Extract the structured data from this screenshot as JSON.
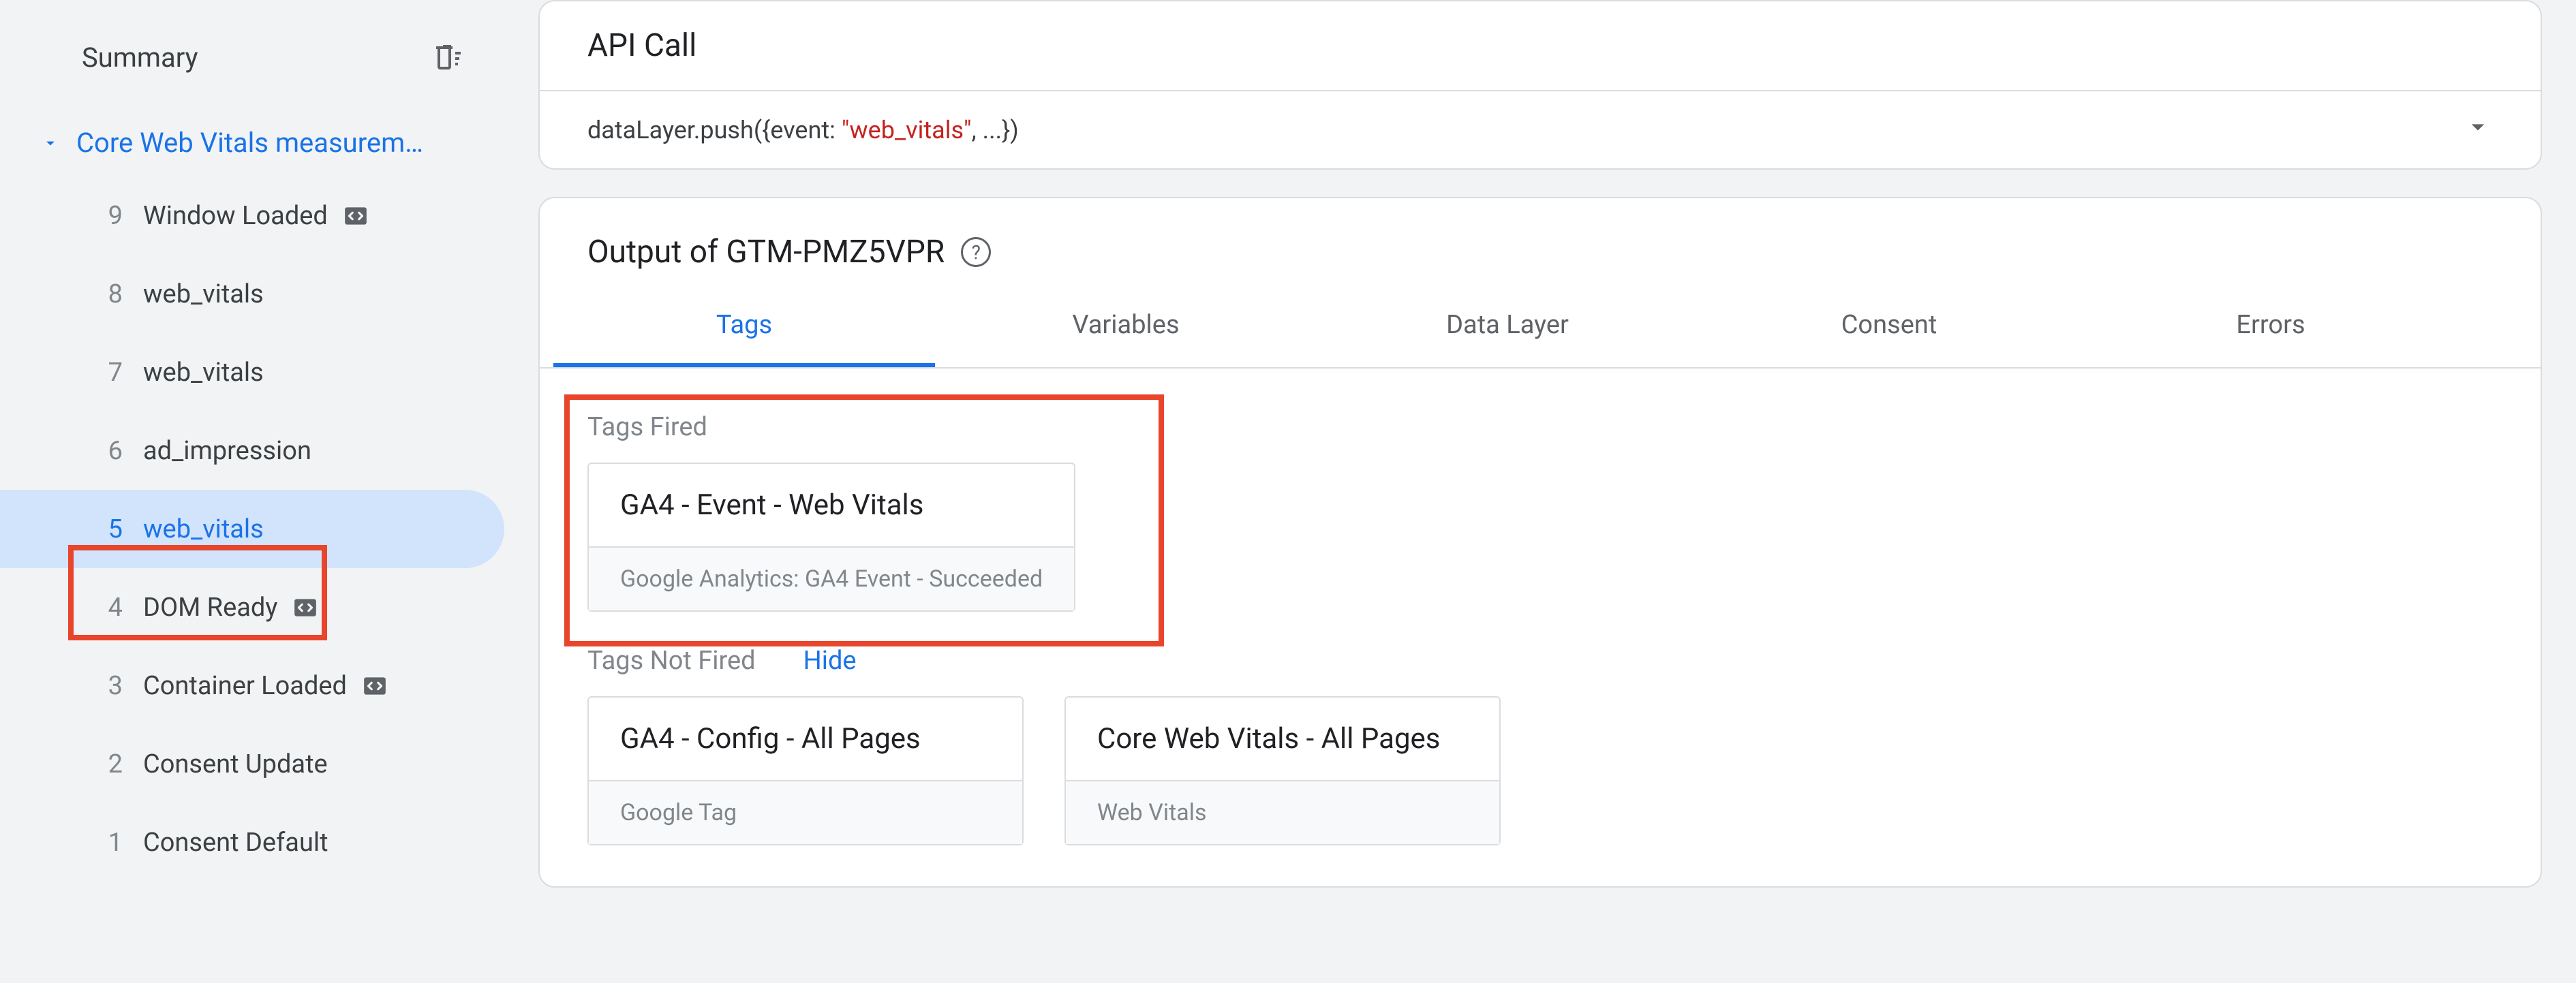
{
  "sidebar": {
    "title": "Summary",
    "group_label": "Core Web Vitals measurem…",
    "events": [
      {
        "num": "9",
        "label": "Window Loaded",
        "icon": true
      },
      {
        "num": "8",
        "label": "web_vitals",
        "icon": false
      },
      {
        "num": "7",
        "label": "web_vitals",
        "icon": false
      },
      {
        "num": "6",
        "label": "ad_impression",
        "icon": false
      },
      {
        "num": "5",
        "label": "web_vitals",
        "icon": false,
        "active": true
      },
      {
        "num": "4",
        "label": "DOM Ready",
        "icon": true
      },
      {
        "num": "3",
        "label": "Container Loaded",
        "icon": true
      },
      {
        "num": "2",
        "label": "Consent Update",
        "icon": false
      },
      {
        "num": "1",
        "label": "Consent Default",
        "icon": false
      }
    ]
  },
  "api": {
    "title": "API Call",
    "code_pre": "dataLayer.push({event: ",
    "code_str": "\"web_vitals\"",
    "code_post": ", ...})"
  },
  "output": {
    "title_pre": "Output of ",
    "container_id": "GTM-PMZ5VPR",
    "help": "?",
    "tabs": [
      "Tags",
      "Variables",
      "Data Layer",
      "Consent",
      "Errors"
    ],
    "active_tab": 0,
    "fired_title": "Tags Fired",
    "not_fired_title": "Tags Not Fired",
    "hide_label": "Hide",
    "fired": [
      {
        "name": "GA4 - Event - Web Vitals",
        "meta": "Google Analytics: GA4 Event - Succeeded"
      }
    ],
    "not_fired": [
      {
        "name": "GA4 - Config - All Pages",
        "meta": "Google Tag"
      },
      {
        "name": "Core Web Vitals - All Pages",
        "meta": "Web Vitals"
      }
    ]
  }
}
